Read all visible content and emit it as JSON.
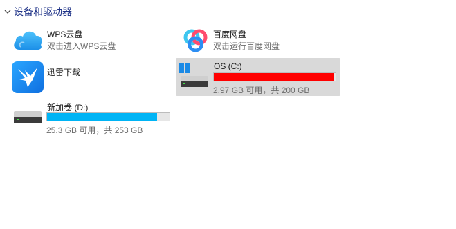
{
  "section": {
    "title": "设备和驱动器",
    "chevron_icon": "chevron-down-icon"
  },
  "items": [
    {
      "name": "WPS云盘",
      "subtitle": "双击进入WPS云盘",
      "icon": "wps-cloud-icon",
      "color": "#2fa8f5"
    },
    {
      "name": "百度网盘",
      "subtitle": "双击运行百度网盘",
      "icon": "baidu-netdisk-icon",
      "color": "#3ec6ef"
    },
    {
      "name": "迅雷下载",
      "icon": "xunlei-bird-icon",
      "color": "#1b86f0"
    },
    {
      "name": "OS (C:)",
      "free_text": "2.97 GB 可用，共 200 GB",
      "icon": "windows-drive-icon",
      "usage_fraction": 0.985,
      "bar_color": "#ff0000",
      "selected": true
    },
    {
      "name": "新加卷 (D:)",
      "free_text": "25.3 GB 可用，共 253 GB",
      "icon": "hard-drive-icon",
      "usage_fraction": 0.9,
      "bar_color": "#00b4f5"
    }
  ]
}
